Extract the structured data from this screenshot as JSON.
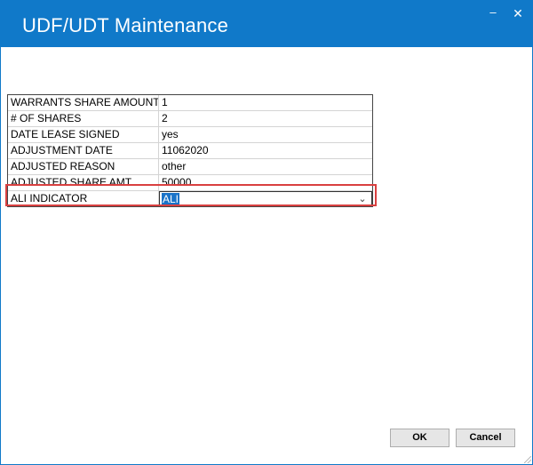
{
  "window": {
    "title": "UDF/UDT Maintenance",
    "minimize_glyph": "–",
    "close_glyph": "✕"
  },
  "grid": {
    "rows": [
      {
        "label": "WARRANTS SHARE AMOUNT",
        "value": "1"
      },
      {
        "label": "# OF SHARES",
        "value": "2"
      },
      {
        "label": "DATE LEASE SIGNED",
        "value": "yes"
      },
      {
        "label": "ADJUSTMENT DATE",
        "value": "11062020"
      },
      {
        "label": "ADJUSTED REASON",
        "value": "other"
      },
      {
        "label": "ADJUSTED SHARE AMT",
        "value": "50000"
      },
      {
        "label": "ALI INDICATOR",
        "value": "ALI"
      }
    ],
    "dropdown_icon": "chevron-down"
  },
  "buttons": {
    "ok": "OK",
    "cancel": "Cancel"
  },
  "colors": {
    "titlebar": "#1079c9",
    "highlight": "#d94040",
    "selection": "#1a73c8"
  }
}
